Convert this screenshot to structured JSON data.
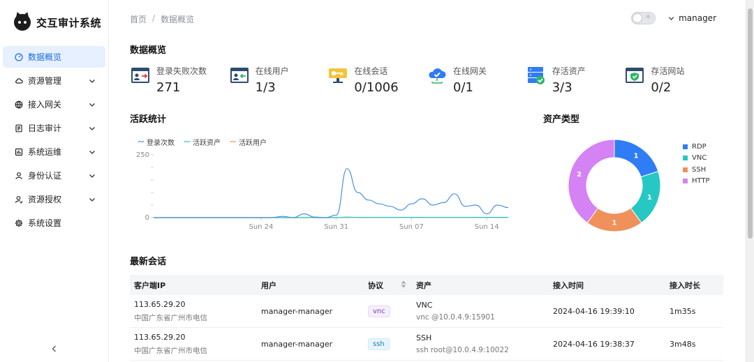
{
  "app": {
    "name": "交互审计系统"
  },
  "sidebar": {
    "items": [
      {
        "label": "数据概览",
        "icon": "dashboard-icon",
        "active": true,
        "expandable": false
      },
      {
        "label": "资源管理",
        "icon": "cloud-resource-icon",
        "expandable": true
      },
      {
        "label": "接入网关",
        "icon": "gateway-icon",
        "expandable": true
      },
      {
        "label": "日志审计",
        "icon": "audit-log-icon",
        "expandable": true
      },
      {
        "label": "系统运维",
        "icon": "ops-icon",
        "expandable": true
      },
      {
        "label": "身份认证",
        "icon": "user-icon",
        "expandable": true
      },
      {
        "label": "资源授权",
        "icon": "authorize-icon",
        "expandable": true
      },
      {
        "label": "系统设置",
        "icon": "gear-icon",
        "expandable": false
      }
    ]
  },
  "breadcrumb": {
    "home": "首页",
    "separator": "/",
    "current": "数据概览"
  },
  "header": {
    "username": "manager",
    "theme_icon": "☼"
  },
  "overview": {
    "title": "数据概览",
    "stats": [
      {
        "label": "登录失败次数",
        "value": "271",
        "icon": "login-failed-icon"
      },
      {
        "label": "在线用户",
        "value": "1/3",
        "icon": "online-user-icon"
      },
      {
        "label": "在线会话",
        "value": "0/1006",
        "icon": "session-key-icon"
      },
      {
        "label": "在线网关",
        "value": "0/1",
        "icon": "cloud-gateway-icon"
      },
      {
        "label": "存活资产",
        "value": "3/3",
        "icon": "server-check-icon"
      },
      {
        "label": "存活网站",
        "value": "0/2",
        "icon": "website-shield-icon"
      }
    ]
  },
  "activity": {
    "title": "活跃统计"
  },
  "assets": {
    "title": "资产类型"
  },
  "sessions": {
    "title": "最新会话",
    "columns": [
      "客户端IP",
      "用户",
      "协议",
      "资产",
      "接入时间",
      "接入时长"
    ],
    "rows": [
      {
        "ip": "113.65.29.20",
        "location": "中国广东省广州市电信",
        "user": "manager-manager",
        "protocol": "vnc",
        "asset_name": "VNC",
        "asset_detail": "vnc @10.0.4.9:15901",
        "time": "2024-04-16 19:39:10",
        "duration": "1m35s"
      },
      {
        "ip": "113.65.29.20",
        "location": "中国广东省广州市电信",
        "user": "manager-manager",
        "protocol": "ssh",
        "asset_name": "SSH",
        "asset_detail": "ssh root@10.0.4.9:10022",
        "time": "2024-04-16 19:38:37",
        "duration": "3m48s"
      }
    ]
  },
  "colors": {
    "accent": "#1d6ae5",
    "rdp": "#2f7cf6",
    "vnc": "#27c8c4",
    "ssh": "#f0905a",
    "http": "#d582f4"
  },
  "chart_data": [
    {
      "type": "line",
      "ylim": [
        0,
        250
      ],
      "ytick_labels": [
        "250",
        "0"
      ],
      "xtick_labels": [
        "Sun 24",
        "Sun 31",
        "Sun 07",
        "Sun 14"
      ],
      "xtick_positions": [
        10,
        17,
        24,
        31
      ],
      "x": [
        0,
        1,
        2,
        3,
        4,
        5,
        6,
        7,
        8,
        9,
        10,
        11,
        12,
        13,
        14,
        15,
        16,
        17,
        18,
        19,
        20,
        21,
        22,
        23,
        24,
        25,
        26,
        27,
        28,
        29,
        30,
        31,
        32,
        33
      ],
      "series": [
        {
          "name": "登录次数",
          "color": "#4b8fe2",
          "values": [
            0,
            0,
            0,
            0,
            0,
            0,
            0,
            0,
            0,
            0,
            0,
            0,
            5,
            0,
            15,
            2,
            0,
            10,
            195,
            100,
            70,
            55,
            45,
            30,
            55,
            75,
            50,
            60,
            95,
            45,
            50,
            15,
            50,
            40
          ]
        },
        {
          "name": "活跃资产",
          "color": "#27c8c4",
          "values": [
            0,
            0,
            0,
            0,
            0,
            0,
            0,
            0,
            0,
            0,
            0,
            0,
            0,
            0,
            0,
            0,
            0,
            0,
            2,
            1,
            1,
            1,
            1,
            1,
            1,
            1,
            1,
            1,
            1,
            1,
            1,
            1,
            1,
            1
          ]
        },
        {
          "name": "活跃用户",
          "color": "#f0905a",
          "values": [
            0,
            0,
            0,
            0,
            0,
            0,
            0,
            0,
            0,
            0,
            0,
            0,
            0,
            0,
            0,
            0,
            0,
            0,
            1,
            1,
            1,
            1,
            1,
            1,
            1,
            1,
            1,
            1,
            1,
            1,
            1,
            1,
            1,
            1
          ]
        }
      ]
    },
    {
      "type": "pie",
      "categories": [
        "RDP",
        "VNC",
        "SSH",
        "HTTP"
      ],
      "values": [
        1,
        1,
        1,
        2
      ],
      "colors": [
        "#2f7cf6",
        "#27c8c4",
        "#f0905a",
        "#d582f4"
      ],
      "legend": "right"
    }
  ]
}
